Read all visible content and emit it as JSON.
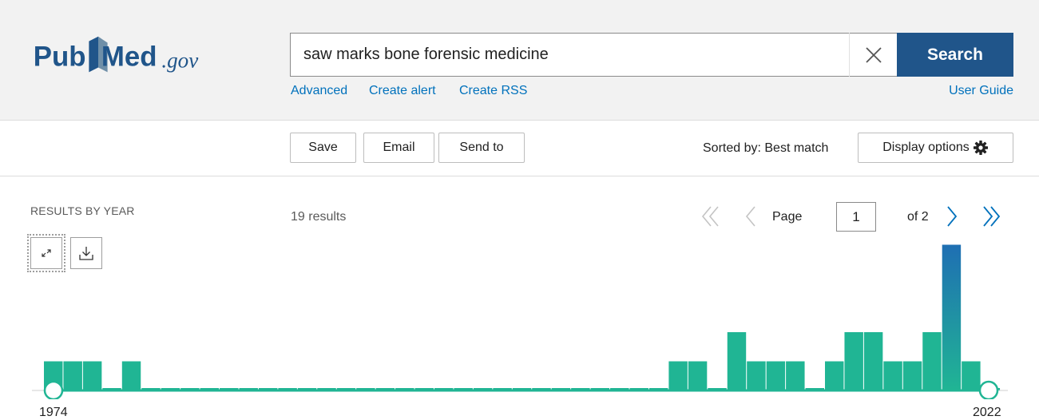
{
  "header": {
    "logo_text_pub": "Pub",
    "logo_text_med": "Med",
    "logo_text_gov": ".gov",
    "search_value": "saw marks bone forensic medicine",
    "search_button": "Search",
    "links": {
      "advanced": "Advanced",
      "create_alert": "Create alert",
      "create_rss": "Create RSS",
      "user_guide": "User Guide"
    }
  },
  "actions": {
    "save": "Save",
    "email": "Email",
    "send_to": "Send to",
    "sorted_by": "Sorted by: Best match",
    "display_options": "Display options"
  },
  "results": {
    "results_by_year": "RESULTS BY YEAR",
    "count": "19 results",
    "page_label": "Page",
    "page_value": "1",
    "of_label": "of 2"
  },
  "colors": {
    "brand_blue": "#20558a",
    "link_blue": "#0071bc",
    "bar_teal": "#20b594",
    "bar_highlight_blue": "#1f6fb3"
  },
  "chart_data": {
    "type": "bar",
    "start_year": "1974",
    "end_year": "2022",
    "years": [
      "1974",
      "1975",
      "1976",
      "1977",
      "1978",
      "1979",
      "1980",
      "1981",
      "1982",
      "1983",
      "1984",
      "1985",
      "1986",
      "1987",
      "1988",
      "1989",
      "1990",
      "1991",
      "1992",
      "1993",
      "1994",
      "1995",
      "1996",
      "1997",
      "1998",
      "1999",
      "2000",
      "2001",
      "2002",
      "2003",
      "2004",
      "2005",
      "2006",
      "2007",
      "2008",
      "2009",
      "2010",
      "2011",
      "2012",
      "2013",
      "2014",
      "2015",
      "2016",
      "2017",
      "2018",
      "2019",
      "2020",
      "2021",
      "2022"
    ],
    "values": [
      1,
      1,
      1,
      0,
      1,
      0,
      0,
      0,
      0,
      0,
      0,
      0,
      0,
      0,
      0,
      0,
      0,
      0,
      0,
      0,
      0,
      0,
      0,
      0,
      0,
      0,
      0,
      0,
      0,
      0,
      0,
      0,
      1,
      1,
      0,
      2,
      1,
      1,
      1,
      0,
      1,
      2,
      2,
      1,
      1,
      2,
      5,
      1,
      0
    ],
    "highlight_index": 46
  }
}
